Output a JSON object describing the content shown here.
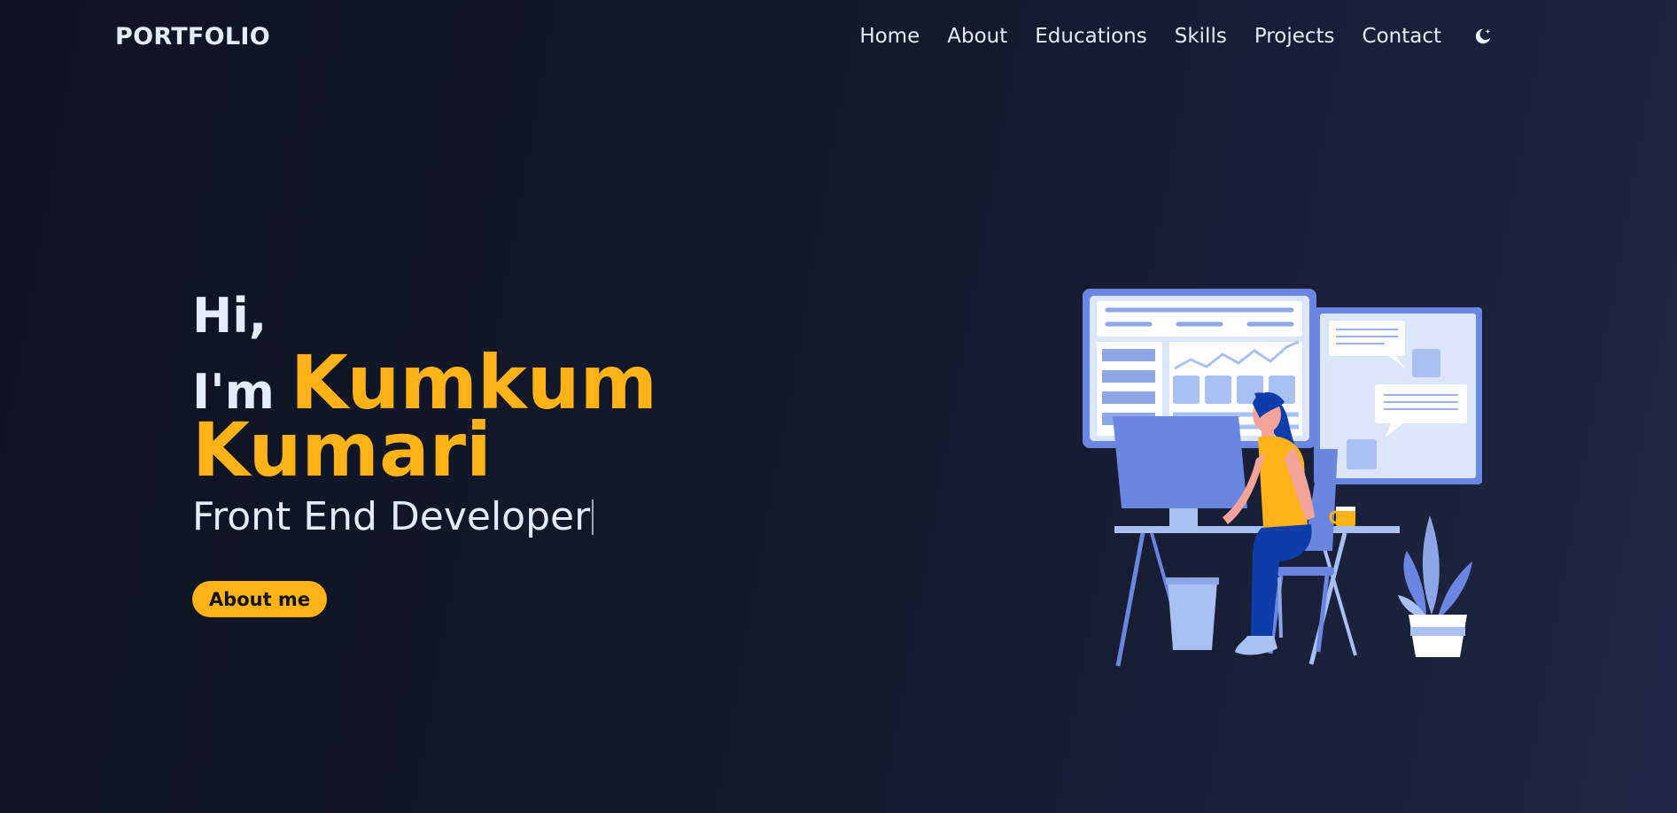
{
  "nav": {
    "logo": "PORTFOLIO",
    "items": [
      {
        "label": "Home"
      },
      {
        "label": "About"
      },
      {
        "label": "Educations"
      },
      {
        "label": "Skills"
      },
      {
        "label": "Projects"
      },
      {
        "label": "Contact"
      }
    ],
    "theme_icon": "moon-icon"
  },
  "hero": {
    "greeting": "Hi,",
    "im": "I'm",
    "first_name": "Kumkum",
    "last_name": "Kumari",
    "role": "Front End Developer",
    "button_label": "About me"
  },
  "illustration": {
    "icon": "developer-at-desk-illustration"
  },
  "colors": {
    "accent": "#fdb217",
    "text": "#e3ecfb",
    "background": "#0f1322",
    "illustration_primary": "#6a86e0",
    "illustration_light": "#dbe6fb"
  }
}
